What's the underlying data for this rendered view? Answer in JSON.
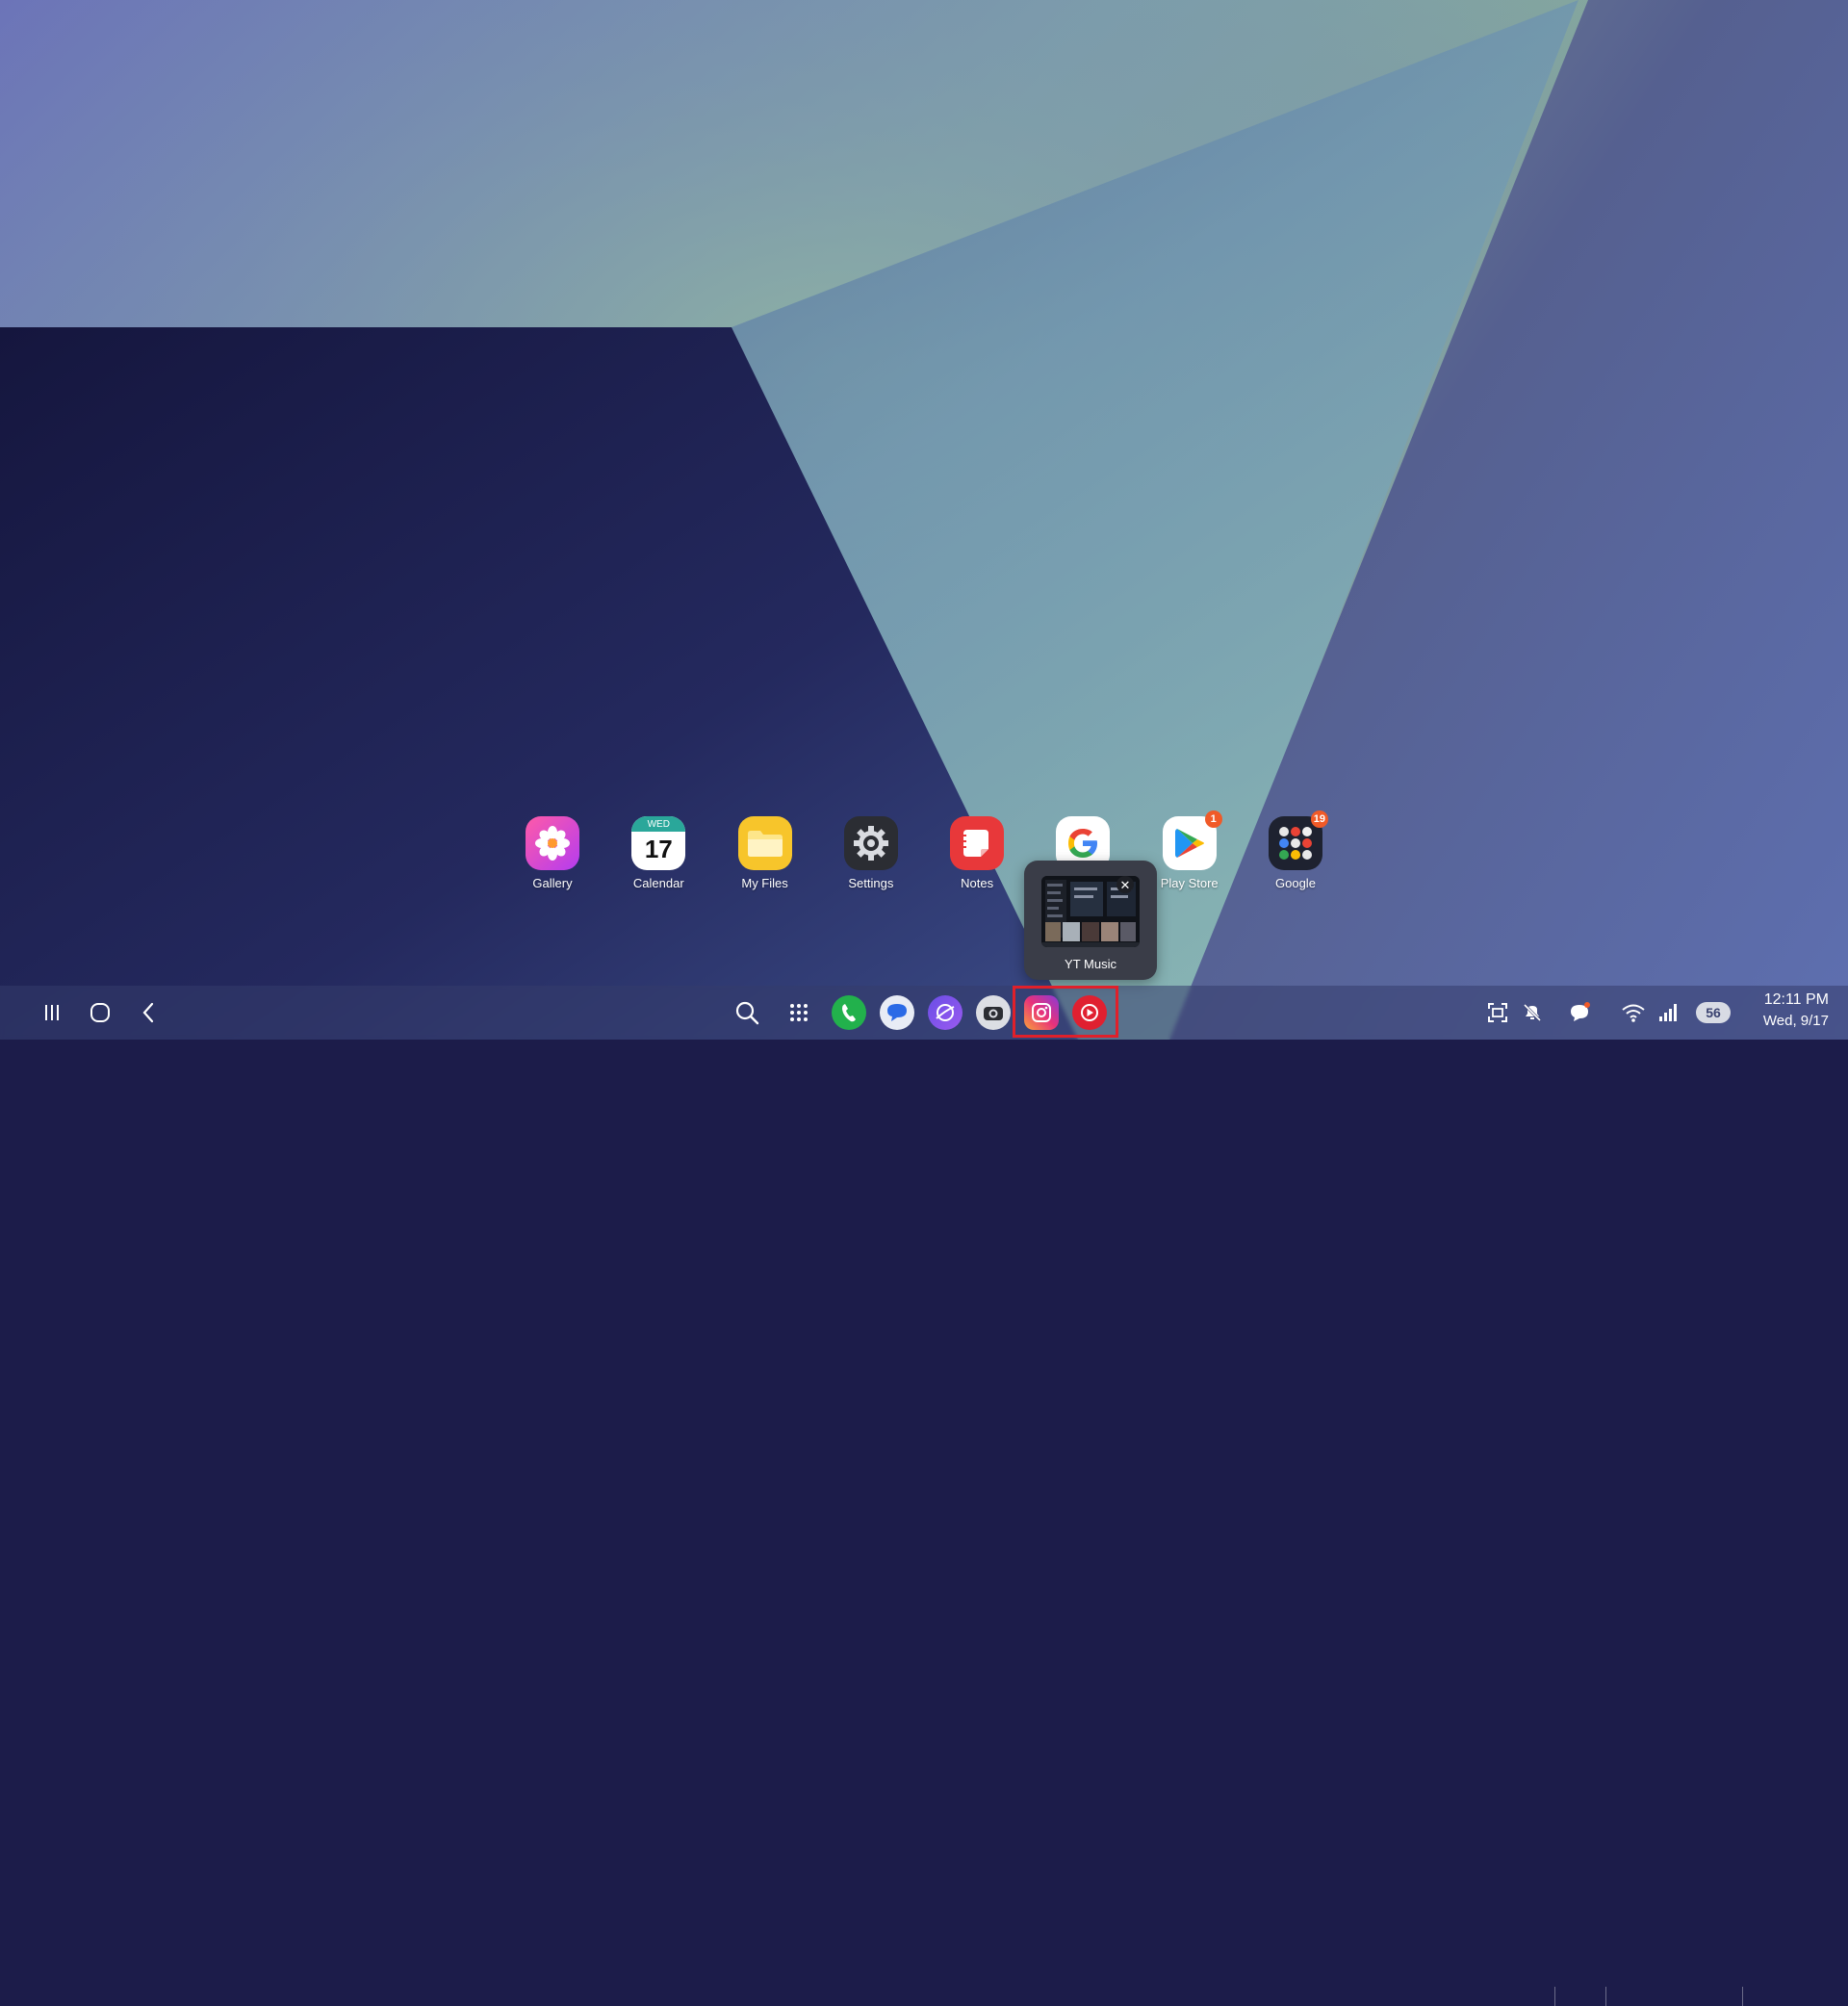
{
  "colors": {
    "taskbar": "#343c6c",
    "highlight": "#e0202a",
    "badge": "#f05a28"
  },
  "home_apps": [
    {
      "label": "Gallery",
      "icon": "gallery-icon"
    },
    {
      "label": "Calendar",
      "icon": "calendar-icon",
      "calendar_day": "WED",
      "calendar_date": "17"
    },
    {
      "label": "My Files",
      "icon": "folder-icon"
    },
    {
      "label": "Settings",
      "icon": "gear-icon"
    },
    {
      "label": "Notes",
      "icon": "notes-icon"
    },
    {
      "label": "",
      "icon": "google-icon"
    },
    {
      "label": "Play Store",
      "icon": "play-store-icon",
      "badge": "1"
    },
    {
      "label": "Google",
      "icon": "google-folder-icon",
      "badge": "19"
    }
  ],
  "preview": {
    "title": "YT Music",
    "close": "✕"
  },
  "taskbar": {
    "nav": [
      "recents-icon",
      "home-icon",
      "back-icon"
    ],
    "apps": [
      "search-icon",
      "app-drawer-icon",
      "phone-icon",
      "messages-icon",
      "internet-icon",
      "camera-icon",
      "instagram-icon",
      "yt-music-icon"
    ]
  },
  "status": {
    "battery": "56",
    "time": "12:11 PM",
    "date": "Wed, 9/17"
  }
}
